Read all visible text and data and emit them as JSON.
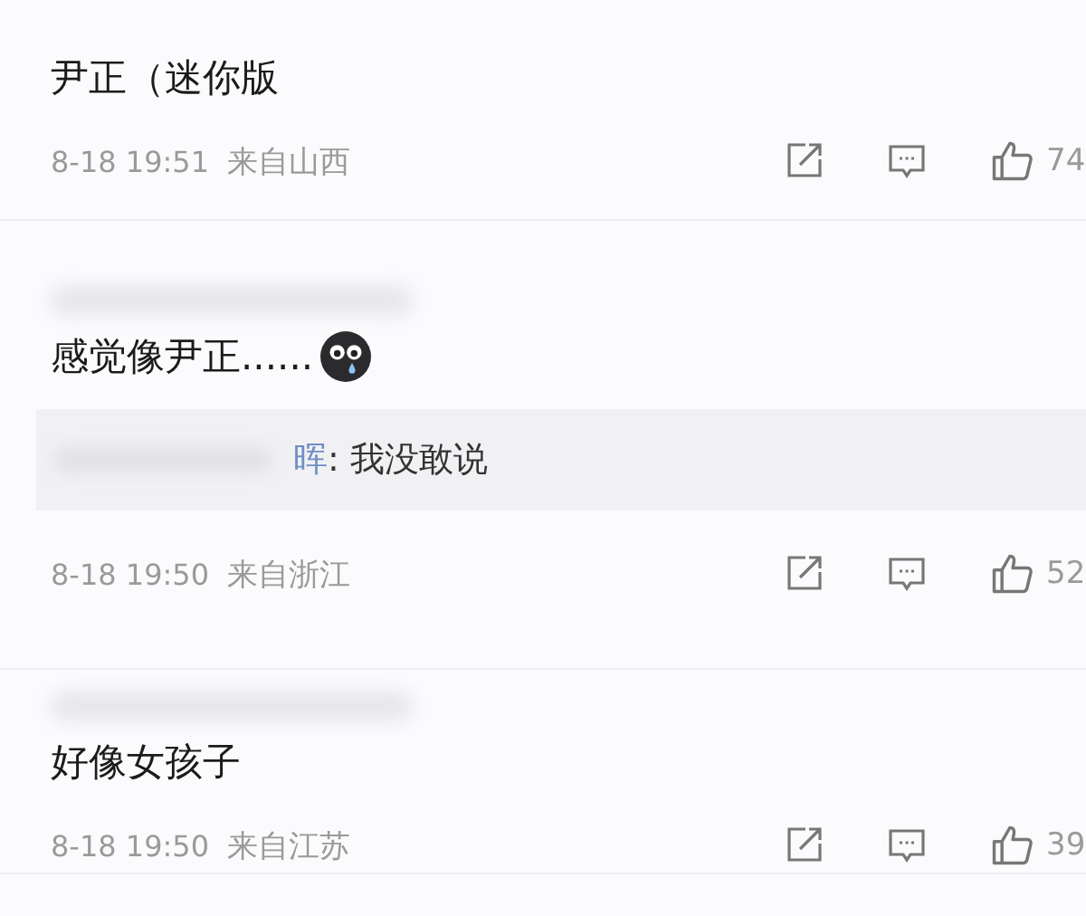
{
  "comments": [
    {
      "name_hidden": false,
      "text": "尹正（迷你版",
      "emoji": false,
      "date": "8-18 19:51",
      "location": "来自山西",
      "likes": "74"
    },
    {
      "name_hidden": true,
      "text": "感觉像尹正......",
      "emoji": true,
      "reply": {
        "author": "晖",
        "text": ": 我没敢说"
      },
      "date": "8-18 19:50",
      "location": "来自浙江",
      "likes": "52"
    },
    {
      "name_hidden": true,
      "text": "好像女孩子",
      "emoji": false,
      "date": "8-18 19:50",
      "location": "来自江苏",
      "likes": "39"
    }
  ]
}
